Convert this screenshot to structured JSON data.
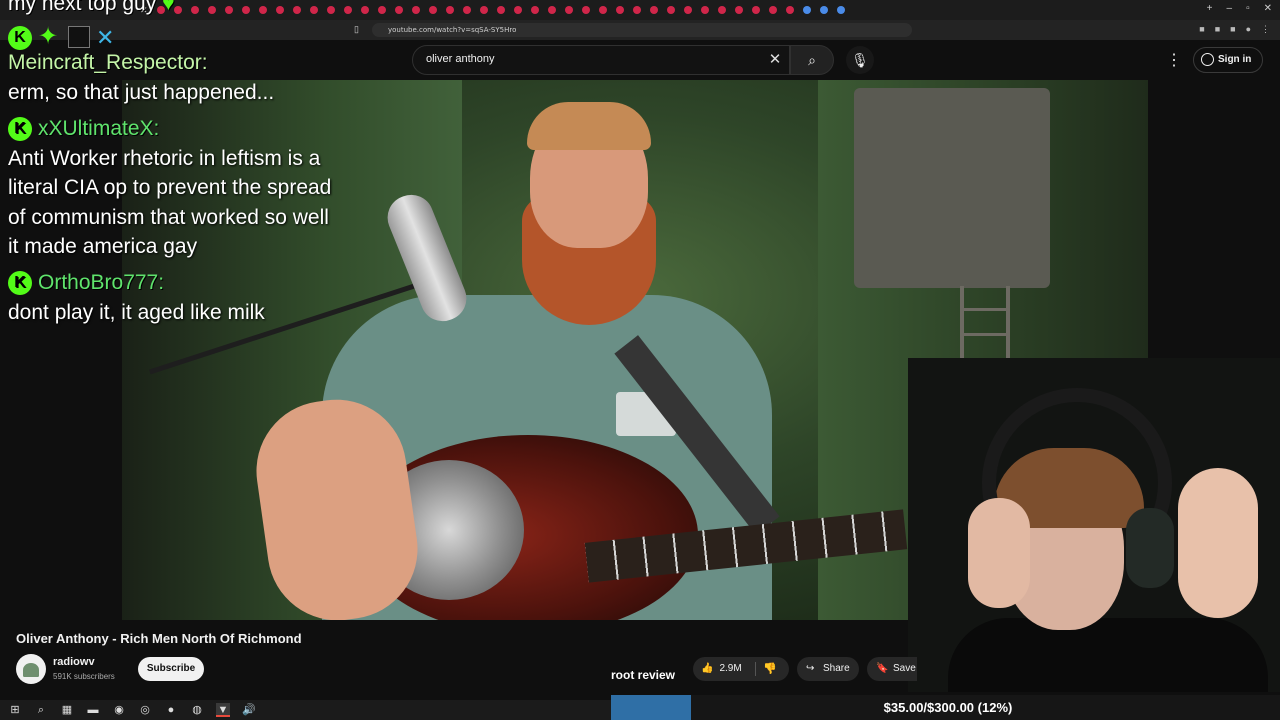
{
  "browser": {
    "url": "youtube.com/watch?v=sqSA-SY5Hro"
  },
  "header": {
    "search_value": "oliver anthony",
    "signin_label": "Sign in"
  },
  "chat": {
    "top_line": "my next top guy",
    "messages": [
      {
        "user": "Meincraft_Respector:",
        "text": "erm, so that just happened..."
      },
      {
        "user": "xXUltimateX:",
        "text": "Anti Worker rhetoric in leftism is a literal CIA op to prevent the spread of communism that worked so well it made america gay"
      },
      {
        "user": "OrthoBro777:",
        "text": "dont play it, it aged like milk"
      }
    ],
    "badge_letter": "K"
  },
  "video": {
    "title": "Oliver Anthony - Rich Men North Of Richmond",
    "channel_name": "radiowv",
    "subscribers": "591K subscribers",
    "subscribe_label": "Subscribe",
    "likes": "2.9M",
    "share_label": "Share",
    "save_label": "Save"
  },
  "overlay": {
    "caption": "root review"
  },
  "donation": {
    "text": "$35.00/$300.00 (12%)",
    "progress": 0.12
  },
  "icons": {
    "search": "search-icon",
    "mic": "mic-icon",
    "clear": "close-icon",
    "kebab": "more-vert-icon",
    "like": "thumbs-up-icon",
    "dislike": "thumbs-down-icon",
    "share": "share-icon",
    "save": "bookmark-icon"
  },
  "colors": {
    "kick_green": "#53fc18",
    "chat_name": "#5fe36c",
    "donation_bar": "#2f6fa6"
  }
}
